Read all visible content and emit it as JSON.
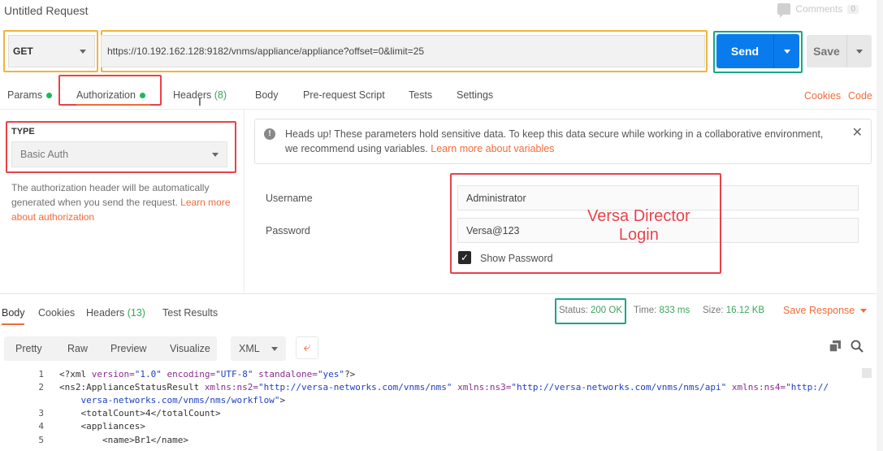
{
  "title": "Untitled Request",
  "comments": {
    "label": "Comments",
    "count": "0"
  },
  "request": {
    "method": "GET",
    "url": "https://10.192.162.128:9182/vnms/appliance/appliance?offset=0&limit=25",
    "send_label": "Send",
    "save_label": "Save"
  },
  "tabs": [
    {
      "label": "Params"
    },
    {
      "label": "Authorization"
    },
    {
      "label": "Headers",
      "count": "(8)"
    },
    {
      "label": "Body"
    },
    {
      "label": "Pre-request Script"
    },
    {
      "label": "Tests"
    },
    {
      "label": "Settings"
    }
  ],
  "links": {
    "cookies": "Cookies",
    "code": "Code"
  },
  "auth": {
    "type_label": "TYPE",
    "type_value": "Basic Auth",
    "help_text": "The authorization header will be automatically generated when you send the request. ",
    "help_link": "Learn more about authorization"
  },
  "alert": {
    "text": "Heads up! These parameters hold sensitive data. To keep this data secure while working in a collaborative environment, we recommend using variables. ",
    "link": "Learn more about variables"
  },
  "fields": {
    "username_label": "Username",
    "username_value": "Administrator",
    "password_label": "Password",
    "password_value": "Versa@123",
    "show_password": "Show Password"
  },
  "annotation": {
    "line1": "Versa Director",
    "line2": "Login"
  },
  "response": {
    "tabs": [
      {
        "label": "Body"
      },
      {
        "label": "Cookies"
      },
      {
        "label": "Headers",
        "count": "(13)"
      },
      {
        "label": "Test Results"
      }
    ],
    "status_label": "Status:",
    "status_value": "200 OK",
    "time_label": "Time:",
    "time_value": "833 ms",
    "size_label": "Size:",
    "size_value": "16.12 KB",
    "save_response": "Save Response",
    "formats": [
      "Pretty",
      "Raw",
      "Preview",
      "Visualize"
    ],
    "language": "XML"
  },
  "code": {
    "line_numbers": [
      "1",
      "2",
      "",
      "3",
      "4",
      "5"
    ],
    "l1_a": "<?xml ",
    "l1_b": "version=",
    "l1_c": "\"1.0\"",
    "l1_d": " encoding=",
    "l1_e": "\"UTF-8\"",
    "l1_f": " standalone=",
    "l1_g": "\"yes\"",
    "l1_h": "?>",
    "l2_a": "<ns2:ApplianceStatusResult ",
    "l2_b": "xmlns:ns2=",
    "l2_c": "\"http://versa-networks.com/vnms/nms\"",
    "l2_d": " xmlns:ns3=",
    "l2_e": "\"http://versa-networks.com/vnms/nms/api\"",
    "l2_f": " xmlns:ns4=",
    "l2_g": "\"http://",
    "l2b": "    versa-networks.com/vnms/nms/workflow\"",
    "l2b_end": ">",
    "l3": "    <totalCount>4</totalCount>",
    "l4": "    <appliances>",
    "l5": "        <name>Br1</name>"
  }
}
